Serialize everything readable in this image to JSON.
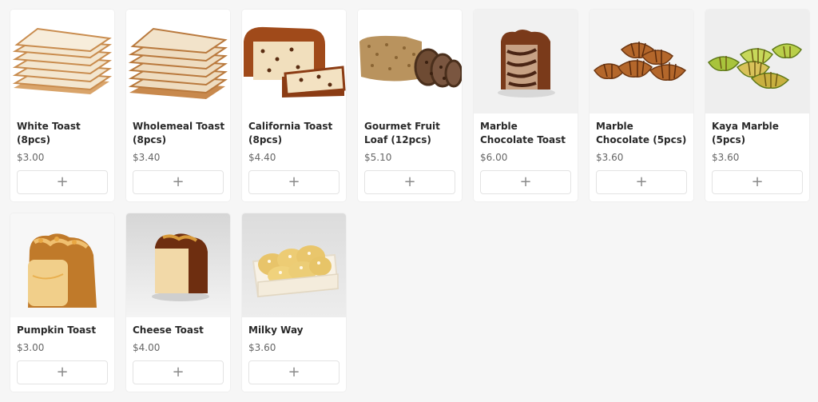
{
  "add_label": "+",
  "products": [
    {
      "name": "White Toast (8pcs)",
      "price": "$3.00",
      "image": "white-toast-image"
    },
    {
      "name": "Wholemeal Toast (8pcs)",
      "price": "$3.40",
      "image": "wholemeal-toast-image"
    },
    {
      "name": "California Toast (8pcs)",
      "price": "$4.40",
      "image": "california-toast-image"
    },
    {
      "name": "Gourmet Fruit Loaf (12pcs)",
      "price": "$5.10",
      "image": "gourmet-fruit-loaf-image"
    },
    {
      "name": "Marble Chocolate Toast",
      "price": "$6.00",
      "image": "marble-chocolate-toast-image"
    },
    {
      "name": "Marble Chocolate (5pcs)",
      "price": "$3.60",
      "image": "marble-chocolate-croissant-image"
    },
    {
      "name": "Kaya Marble (5pcs)",
      "price": "$3.60",
      "image": "kaya-marble-croissant-image"
    },
    {
      "name": "Pumpkin Toast",
      "price": "$3.00",
      "image": "pumpkin-toast-image"
    },
    {
      "name": "Cheese Toast",
      "price": "$4.00",
      "image": "cheese-toast-image"
    },
    {
      "name": "Milky Way",
      "price": "$3.60",
      "image": "milky-way-bun-image"
    }
  ],
  "colors": {
    "background": "#f6f6f6",
    "card": "#ffffff",
    "price_text": "#666666",
    "button_border": "#e3e3e3"
  }
}
